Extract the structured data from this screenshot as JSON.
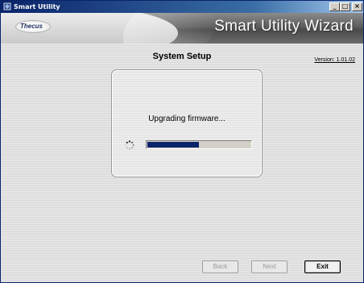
{
  "window": {
    "title": "Smart Utility",
    "controls": {
      "minimize": "_",
      "maximize": "□",
      "close": "×"
    }
  },
  "banner": {
    "logo_text": "Thecus",
    "heading": "Smart Utility Wizard"
  },
  "page": {
    "section_title": "System Setup",
    "version": "Version: 1.01.02"
  },
  "progress": {
    "status_text": "Upgrading firmware...",
    "value_percent": 50
  },
  "buttons": {
    "back": "Back",
    "next": "Next",
    "exit": "Exit"
  },
  "colors": {
    "title_bar": "#0a246a",
    "progress_fill": "#0a246a"
  }
}
